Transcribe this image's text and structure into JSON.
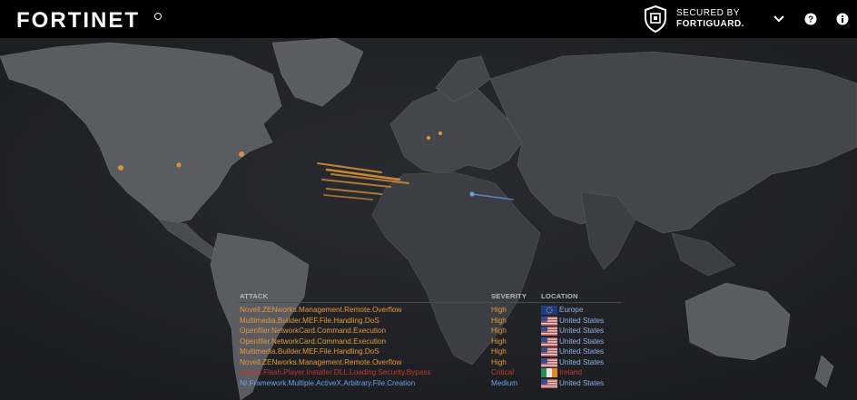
{
  "header": {
    "brand": "FORTINET",
    "secured_line1": "SECURED BY",
    "secured_line2": "FORTIGUARD."
  },
  "icons": {
    "chevron": "chevron-down-icon",
    "help": "help-icon",
    "info": "info-icon"
  },
  "colors": {
    "background": "#1f2024",
    "land": "#3a3b40",
    "attack_high": "#e39a3a",
    "attack_critical": "#c0392b",
    "attack_medium": "#6aa3e8"
  },
  "table": {
    "headers": {
      "attack": "ATTACK",
      "severity": "SEVERITY",
      "location": "LOCATION"
    },
    "rows": [
      {
        "attack": "Novell.ZENworks.Management.Remote.Overflow",
        "severity": "High",
        "location": "Europe",
        "flag": "eu"
      },
      {
        "attack": "Multimedia.Builder.MEF.File.Handling.DoS",
        "severity": "High",
        "location": "United States",
        "flag": "us"
      },
      {
        "attack": "Openfiler.NetworkCard.Command.Execution",
        "severity": "High",
        "location": "United States",
        "flag": "us"
      },
      {
        "attack": "Openfiler.NetworkCard.Command.Execution",
        "severity": "High",
        "location": "United States",
        "flag": "us"
      },
      {
        "attack": "Multimedia.Builder.MEF.File.Handling.DoS",
        "severity": "High",
        "location": "United States",
        "flag": "us"
      },
      {
        "attack": "Novell.ZENworks.Management.Remote.Overflow",
        "severity": "High",
        "location": "United States",
        "flag": "us"
      },
      {
        "attack": "Adobe.Flash.Player.Installer.DLL.Loading.Security.Bypass",
        "severity": "Critical",
        "location": "Ireland",
        "flag": "ie"
      },
      {
        "attack": "NI.Framework.Multiple.ActiveX.Arbitrary.File.Creation",
        "severity": "Medium",
        "location": "United States",
        "flag": "us"
      }
    ]
  }
}
